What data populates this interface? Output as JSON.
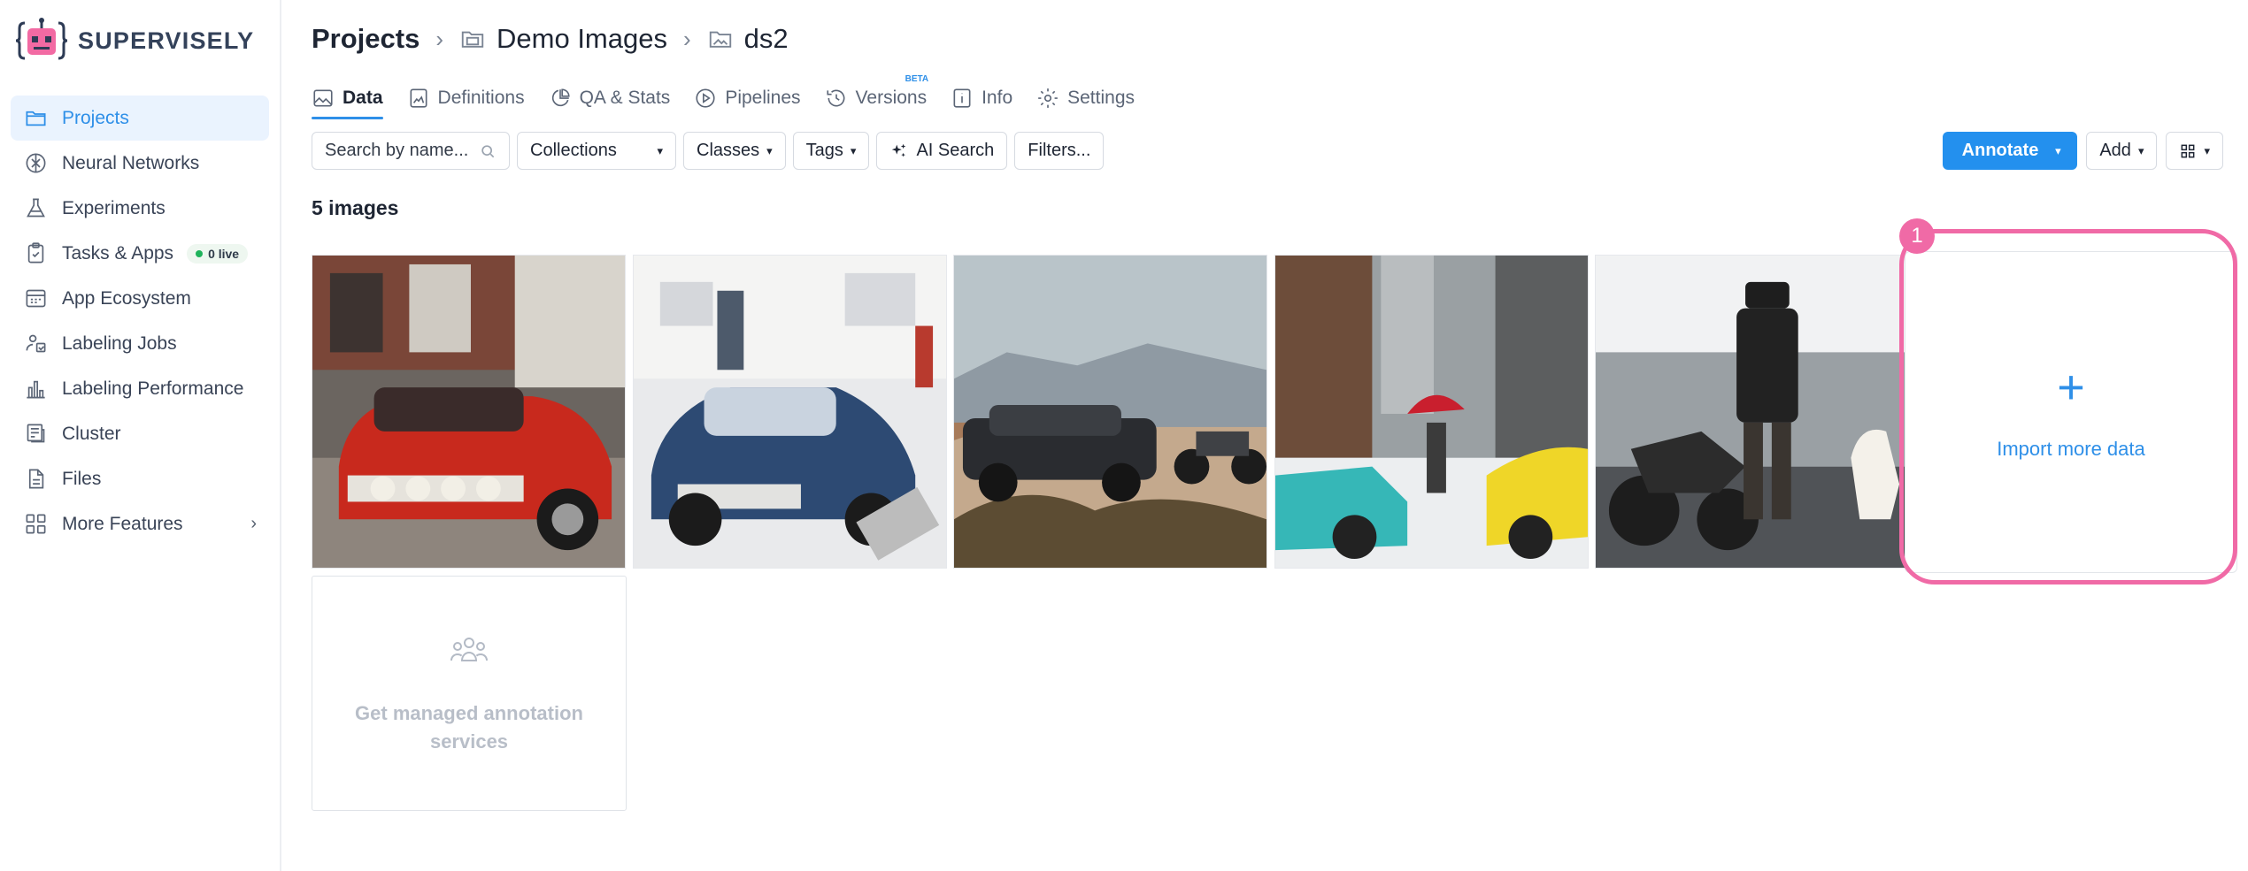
{
  "app": {
    "brand": "SUPERVISELY"
  },
  "sidebar": {
    "items": [
      {
        "label": "Projects",
        "icon": "folder-icon",
        "active": true
      },
      {
        "label": "Neural Networks",
        "icon": "brain-icon"
      },
      {
        "label": "Experiments",
        "icon": "flask-icon"
      },
      {
        "label": "Tasks & Apps",
        "icon": "clipboard-icon",
        "badge": "0 live"
      },
      {
        "label": "App Ecosystem",
        "icon": "apps-icon"
      },
      {
        "label": "Labeling Jobs",
        "icon": "labeling-jobs-icon"
      },
      {
        "label": "Labeling Performance",
        "icon": "bar-chart-icon"
      },
      {
        "label": "Cluster",
        "icon": "server-icon"
      },
      {
        "label": "Files",
        "icon": "file-icon"
      },
      {
        "label": "More Features",
        "icon": "grid-icon",
        "chevron": "›"
      }
    ]
  },
  "breadcrumb": {
    "root": "Projects",
    "separator": "›",
    "project": "Demo Images",
    "dataset": "ds2"
  },
  "tabs": [
    {
      "label": "Data",
      "icon": "image-icon",
      "active": true
    },
    {
      "label": "Definitions",
      "icon": "definitions-icon"
    },
    {
      "label": "QA & Stats",
      "icon": "pie-chart-icon"
    },
    {
      "label": "Pipelines",
      "icon": "play-icon"
    },
    {
      "label": "Versions",
      "icon": "history-icon",
      "badge": "BETA"
    },
    {
      "label": "Info",
      "icon": "info-icon"
    },
    {
      "label": "Settings",
      "icon": "gear-icon"
    }
  ],
  "toolbar": {
    "search_placeholder": "Search by name...",
    "collections": "Collections",
    "classes": "Classes",
    "tags": "Tags",
    "ai_search": "AI Search",
    "filters": "Filters...",
    "annotate": "Annotate",
    "add": "Add"
  },
  "images": {
    "count_label": "5 images",
    "items": [
      {
        "name": "red-classic-car"
      },
      {
        "name": "blue-car-museum"
      },
      {
        "name": "suv-and-motorcycle-desert"
      },
      {
        "name": "snowy-city-street"
      },
      {
        "name": "man-with-dog-and-motorcycle"
      }
    ]
  },
  "import": {
    "plus": "+",
    "label": "Import more data",
    "step": "1"
  },
  "managed": {
    "label": "Get managed annotation services"
  },
  "colors": {
    "accent": "#2390ee",
    "highlight": "#f06aa6",
    "active_bg": "#eaf3fe"
  }
}
